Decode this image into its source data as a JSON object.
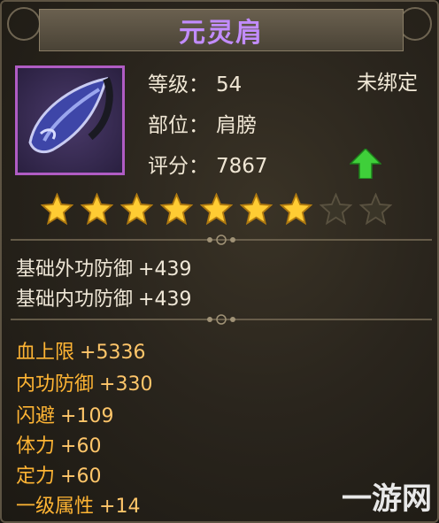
{
  "title": "元灵肩",
  "item": {
    "icon": "shoulder-armor-icon",
    "level_label": "等级：",
    "level_value": "54",
    "slot_label": "部位：",
    "slot_value": "肩膀",
    "score_label": "评分：",
    "score_value": "7867",
    "bind_status": "未绑定"
  },
  "stars": {
    "filled": 7,
    "total": 9
  },
  "base_attributes": [
    {
      "name": "基础外功防御",
      "value": "+439"
    },
    {
      "name": "基础内功防御",
      "value": "+439"
    }
  ],
  "extra_attributes": [
    {
      "name": "血上限",
      "value": "+5336"
    },
    {
      "name": "内功防御",
      "value": "+330"
    },
    {
      "name": "闪避",
      "value": "+109"
    },
    {
      "name": "体力",
      "value": "+60"
    },
    {
      "name": "定力",
      "value": "+60"
    },
    {
      "name": "一级属性",
      "value": "+14"
    }
  ],
  "watermark": "一游网",
  "colors": {
    "title": "#c28cff",
    "extra_attr": "#ffb534",
    "star": "#ffcc33",
    "upgrade_arrow": "#3fcf3a"
  }
}
